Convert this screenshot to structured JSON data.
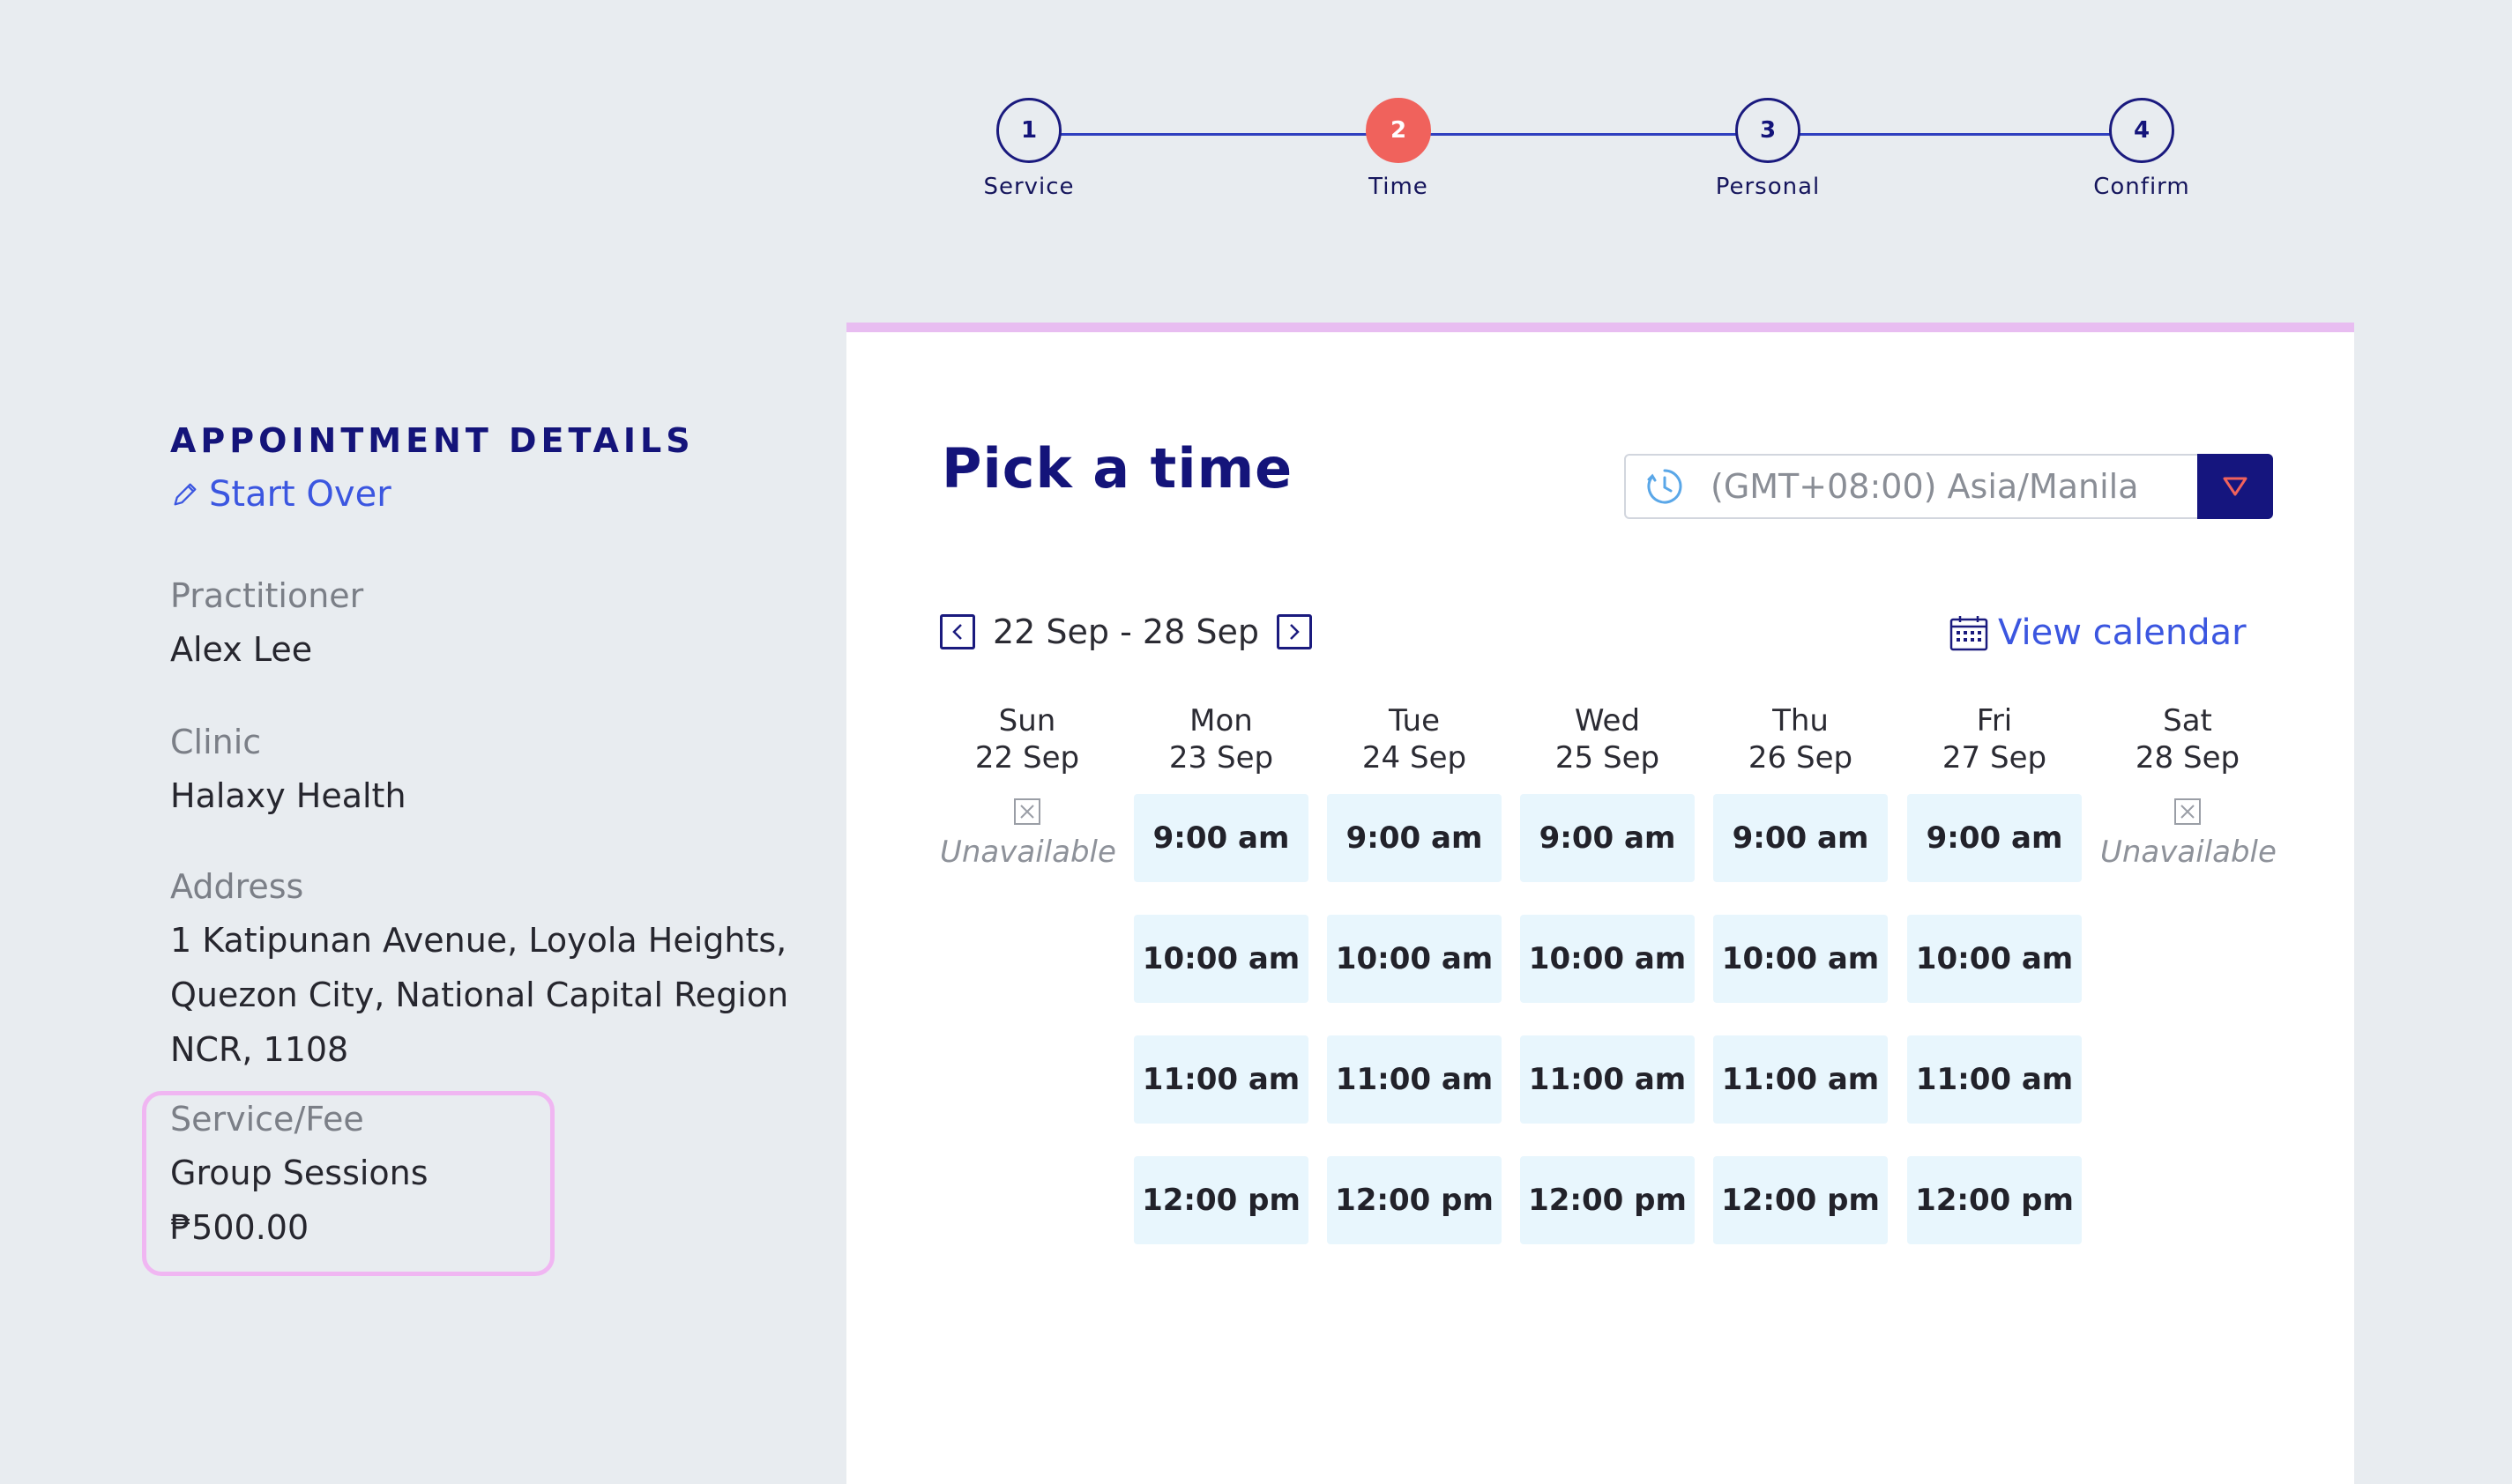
{
  "stepper": {
    "steps": [
      {
        "number": "1",
        "label": "Service"
      },
      {
        "number": "2",
        "label": "Time"
      },
      {
        "number": "3",
        "label": "Personal"
      },
      {
        "number": "4",
        "label": "Confirm"
      }
    ],
    "active_step": 2
  },
  "details": {
    "title": "APPOINTMENT DETAILS",
    "start_over": "Start Over",
    "practitioner_label": "Practitioner",
    "practitioner": "Alex Lee",
    "clinic_label": "Clinic",
    "clinic": "Halaxy Health",
    "address_label": "Address",
    "address_lines": [
      "1 Katipunan Avenue, Loyola Heights,",
      "Quezon City, National Capital Region",
      "NCR, 1108"
    ],
    "service_label": "Service/Fee",
    "service": "Group Sessions",
    "fee": "₱500.00"
  },
  "booking": {
    "title": "Pick a time",
    "timezone": "(GMT+08:00) Asia/Manila",
    "week_range": "22 Sep - 28 Sep",
    "view_calendar": "View calendar",
    "unavailable_text": "Unavailable",
    "days": [
      {
        "name": "Sun",
        "date": "22 Sep",
        "slots": []
      },
      {
        "name": "Mon",
        "date": "23 Sep",
        "slots": [
          "9:00 am",
          "10:00 am",
          "11:00 am",
          "12:00 pm"
        ]
      },
      {
        "name": "Tue",
        "date": "24 Sep",
        "slots": [
          "9:00 am",
          "10:00 am",
          "11:00 am",
          "12:00 pm"
        ]
      },
      {
        "name": "Wed",
        "date": "25 Sep",
        "slots": [
          "9:00 am",
          "10:00 am",
          "11:00 am",
          "12:00 pm"
        ]
      },
      {
        "name": "Thu",
        "date": "26 Sep",
        "slots": [
          "9:00 am",
          "10:00 am",
          "11:00 am",
          "12:00 pm"
        ]
      },
      {
        "name": "Fri",
        "date": "27 Sep",
        "slots": [
          "9:00 am",
          "10:00 am",
          "11:00 am",
          "12:00 pm"
        ]
      },
      {
        "name": "Sat",
        "date": "28 Sep",
        "slots": []
      }
    ]
  },
  "colors": {
    "brand": "#14147a",
    "accent": "#f0625c",
    "link": "#3b56e0",
    "slot_bg": "#e8f6fd",
    "highlight": "#f0b6f2"
  },
  "icons": {
    "start_over": "pencil-icon",
    "timezone": "clock-icon",
    "dropdown": "triangle-down-icon",
    "prev_week": "chevron-left-icon",
    "next_week": "chevron-right-icon",
    "calendar": "calendar-icon",
    "unavailable": "x-box-icon"
  }
}
